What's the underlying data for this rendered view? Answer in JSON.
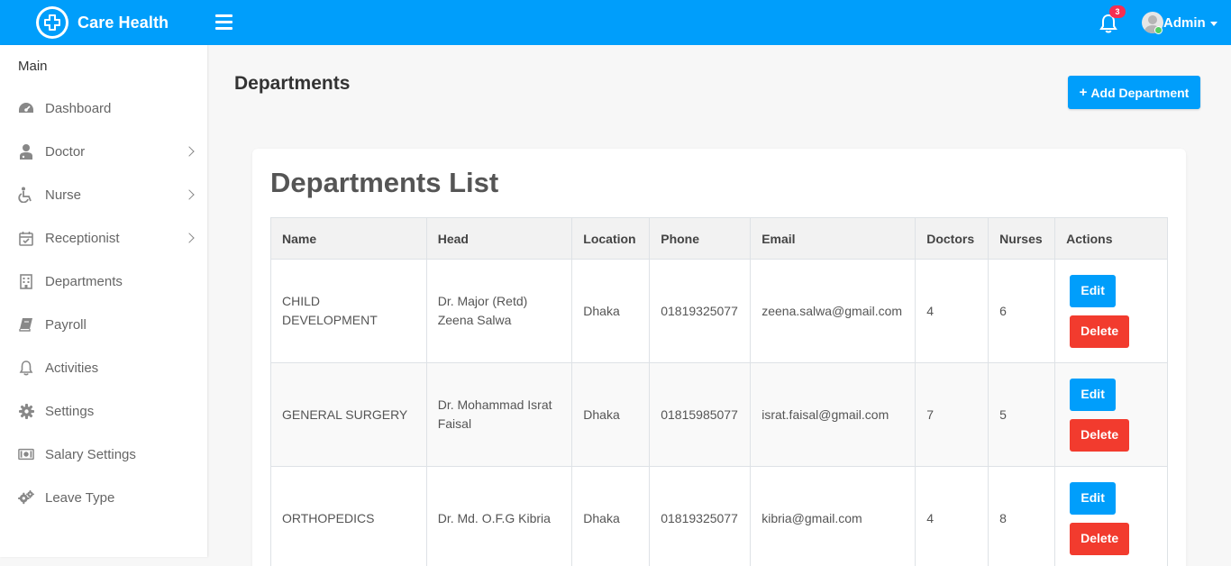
{
  "header": {
    "brand": "Care Health",
    "notification_count": "3",
    "user_name": "Admin"
  },
  "sidebar": {
    "title": "Main",
    "items": [
      {
        "label": "Dashboard",
        "icon": "dashboard-icon",
        "has_submenu": false
      },
      {
        "label": "Doctor",
        "icon": "doctor-icon",
        "has_submenu": true
      },
      {
        "label": "Nurse",
        "icon": "wheelchair-icon",
        "has_submenu": true
      },
      {
        "label": "Receptionist",
        "icon": "calendar-check-icon",
        "has_submenu": true
      },
      {
        "label": "Departments",
        "icon": "hospital-icon",
        "has_submenu": false
      },
      {
        "label": "Payroll",
        "icon": "book-icon",
        "has_submenu": false
      },
      {
        "label": "Activities",
        "icon": "bell-icon",
        "has_submenu": false
      },
      {
        "label": "Settings",
        "icon": "gear-icon",
        "has_submenu": false
      },
      {
        "label": "Salary Settings",
        "icon": "money-bill-icon",
        "has_submenu": false
      },
      {
        "label": "Leave Type",
        "icon": "gears-icon",
        "has_submenu": false
      }
    ]
  },
  "main": {
    "page_title": "Departments",
    "add_button": "Add Department",
    "card_title": "Departments List",
    "table": {
      "columns": [
        "Name",
        "Head",
        "Location",
        "Phone",
        "Email",
        "Doctors",
        "Nurses",
        "Actions"
      ],
      "rows": [
        {
          "name": "CHILD DEVELOPMENT",
          "head_line1": "Dr. Major (Retd)",
          "head_line2": "Zeena Salwa",
          "location": "Dhaka",
          "phone": "01819325077",
          "email": "zeena.salwa@gmail.com",
          "doctors": "4",
          "nurses": "6"
        },
        {
          "name": "GENERAL SURGERY",
          "head_line1": "Dr. Mohammad Israt",
          "head_line2": "Faisal",
          "location": "Dhaka",
          "phone": "01815985077",
          "email": "israt.faisal@gmail.com",
          "doctors": "7",
          "nurses": "5"
        },
        {
          "name": "ORTHOPEDICS",
          "head_line1": "Dr. Md. O.F.G Kibria",
          "head_line2": "",
          "location": "Dhaka",
          "phone": "01819325077",
          "email": "kibria@gmail.com",
          "doctors": "4",
          "nurses": "8"
        }
      ],
      "edit_label": "Edit",
      "delete_label": "Delete"
    }
  },
  "colors": {
    "primary": "#009efb",
    "danger": "#f23b2e",
    "online": "#55ce63"
  }
}
